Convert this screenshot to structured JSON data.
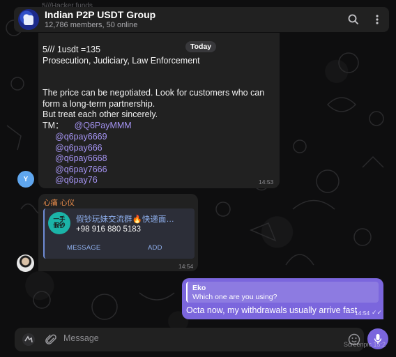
{
  "header": {
    "title": "Indian P2P USDT Group",
    "subtitle": "12,786 members, 50 online",
    "search_icon": "search-icon",
    "menu_icon": "more-vertical-icon"
  },
  "ghost_top": "5///Hacker funds",
  "date_badge": "Today",
  "messages": {
    "first": {
      "text": "5/// 1usdt =135\nProsecution, Judiciary, Law Enforcement\n\n\nThe price can be negotiated. Look for customers who can form a long-term partnership.\nBut treat each other sincerely.",
      "tm_label": "TM：",
      "tm_link": "@Q6PayMMM",
      "links": [
        "@q6pay6669",
        "@q6pay666",
        "@q6pay6668",
        "@q6pay7666",
        "@q6pay76"
      ],
      "time": "14:53",
      "avatar_letter": "Y"
    },
    "second": {
      "sender": "心痛 心仪",
      "contact_name": "假钞玩妹交流群🔥快递面…",
      "contact_phone": "+98 916 880 5183",
      "contact_avatar_text": "一手\n假钞",
      "message_button": "MESSAGE",
      "add_button": "ADD",
      "time": "14:54"
    },
    "third": {
      "reply_name": "Eko",
      "reply_text": "Which one are you using?",
      "text": "Octa now, my withdrawals usually arrive fast",
      "time": "14:54",
      "status_icon": "double-check-icon"
    }
  },
  "composer": {
    "placeholder": "Message",
    "emoji_icon": "emoji-icon",
    "attach_icon": "paperclip-icon",
    "mic_icon": "microphone-icon"
  },
  "watermark": "Screenpic 15:2",
  "colors": {
    "accent": "#7b66dd",
    "link": "#a594f3",
    "sender_name": "#e58a4a",
    "bubble": "#212121"
  }
}
